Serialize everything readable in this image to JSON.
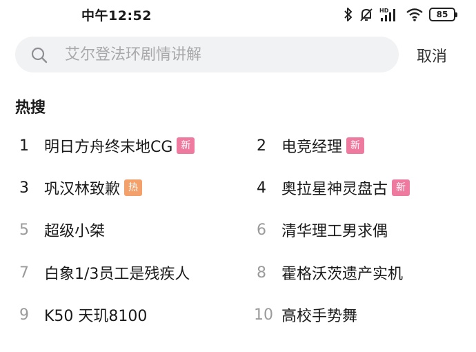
{
  "status_bar": {
    "time": "中午12:52",
    "battery_level": "85",
    "icons": [
      "bluetooth-icon",
      "bell-muted-icon",
      "hd-signal-icon",
      "wifi-icon",
      "battery-icon"
    ]
  },
  "search": {
    "placeholder": "艾尔登法环剧情讲解",
    "cancel_label": "取消"
  },
  "hot_search": {
    "title": "热搜",
    "items": [
      {
        "rank": "1",
        "text": "明日方舟终末地CG",
        "badge": "新"
      },
      {
        "rank": "2",
        "text": "电竞经理",
        "badge": "新"
      },
      {
        "rank": "3",
        "text": "巩汉林致歉",
        "badge": "热"
      },
      {
        "rank": "4",
        "text": "奥拉星神灵盘古",
        "badge": "新"
      },
      {
        "rank": "5",
        "text": "超级小桀",
        "badge": ""
      },
      {
        "rank": "6",
        "text": "清华理工男求偶",
        "badge": ""
      },
      {
        "rank": "7",
        "text": "白象1/3员工是残疾人",
        "badge": ""
      },
      {
        "rank": "8",
        "text": "霍格沃茨遗产实机",
        "badge": ""
      },
      {
        "rank": "9",
        "text": "K50 天玑8100",
        "badge": ""
      },
      {
        "rank": "10",
        "text": "高校手势舞",
        "badge": ""
      }
    ]
  },
  "colors": {
    "badge_new": "#ef7aa0",
    "badge_hot": "#f4a06a",
    "search_bg": "#f1f2f4"
  }
}
